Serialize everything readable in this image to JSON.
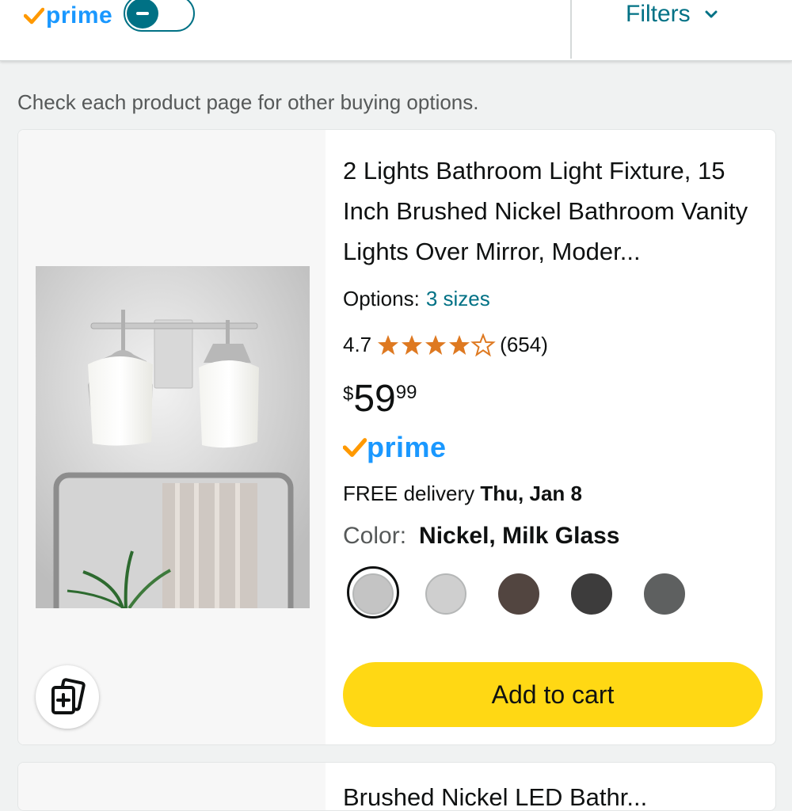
{
  "topbar": {
    "prime_label": "prime",
    "prime_toggle_state": "on",
    "filters_label": "Filters"
  },
  "notice": "Check each product page for other buying options.",
  "product": {
    "title": "2 Lights Bathroom Light Fixture, 15 Inch Brushed Nickel Bathroom Vanity Lights Over Mirror, Moder...",
    "options_label": "Options:",
    "options_link": "3 sizes",
    "rating": "4.7",
    "rating_stars_fraction": 0.94,
    "review_count": "(654)",
    "price_symbol": "$",
    "price_whole": "59",
    "price_fraction": "99",
    "prime_label": "prime",
    "delivery_prefix": "FREE delivery",
    "delivery_date": "Thu, Jan 8",
    "color_label": "Color:",
    "color_value": "Nickel, Milk Glass",
    "swatches": [
      {
        "color": "#c4c4c4",
        "selected": true
      },
      {
        "color": "#cfcfcf",
        "selected": false
      },
      {
        "color": "#524540",
        "selected": false
      },
      {
        "color": "#3d3c3c",
        "selected": false
      },
      {
        "color": "#5e6060",
        "selected": false
      }
    ],
    "add_to_cart_label": "Add to cart"
  },
  "next_product": {
    "title_partial": "Brushed Nickel LED Bathr..."
  },
  "colors": {
    "link": "#007185",
    "prime_blue": "#1a98ff",
    "prime_check": "#ff9900",
    "star": "#de7921",
    "cart_button": "#ffd814"
  }
}
